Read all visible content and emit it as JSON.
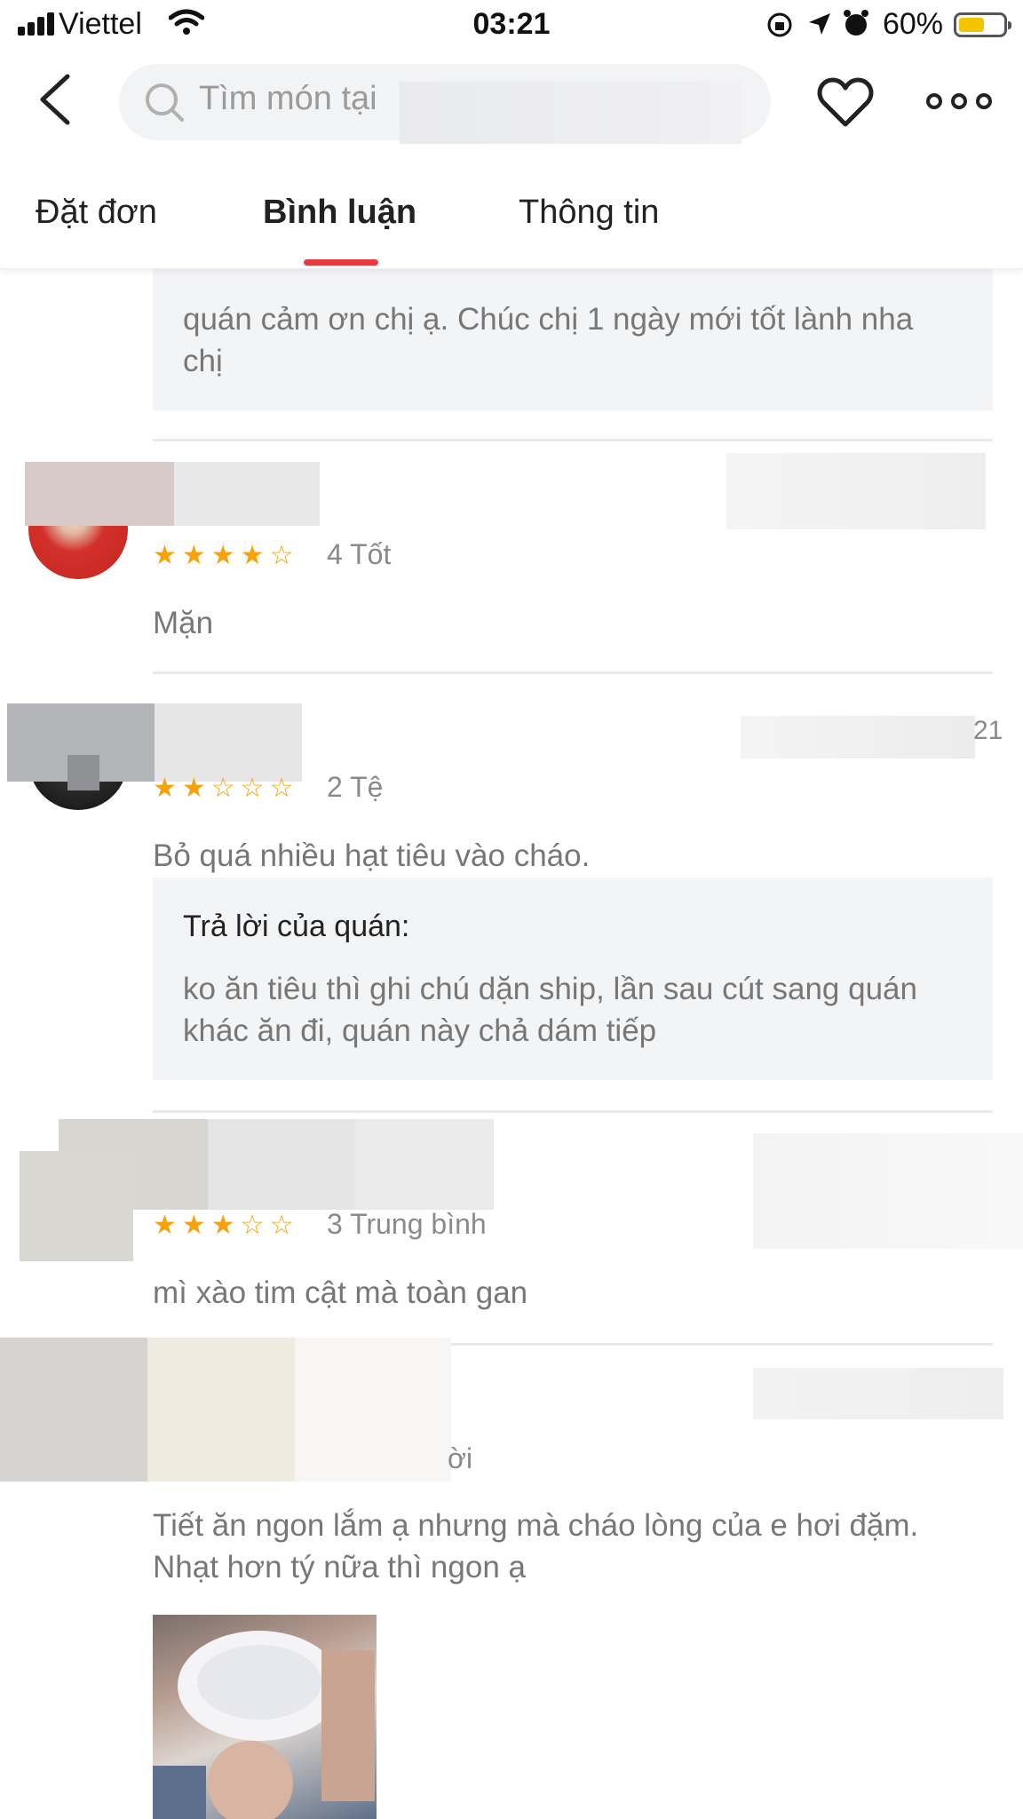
{
  "status": {
    "carrier": "Viettel",
    "time": "03:21",
    "battery": "60%",
    "battery_level": 0.6
  },
  "header": {
    "search_placeholder": "Tìm món tại"
  },
  "tabs": [
    {
      "label": "Đặt đơn"
    },
    {
      "label": "Bình luận",
      "active": true
    },
    {
      "label": "Thông tin"
    }
  ],
  "top_reply": {
    "text": "quán cảm ơn chị ạ. Chúc chị 1 ngày mới tốt lành nha chị"
  },
  "reviews": [
    {
      "stars_shown": "★★★★☆",
      "rating": 4,
      "rating_label": "4 Tốt",
      "comment": "Mặn"
    },
    {
      "stars_shown": "★★☆☆☆",
      "rating": 2,
      "rating_label": "2 Tệ",
      "comment": "Bỏ quá nhiều hạt tiêu vào cháo.",
      "reply_title": "Trả lời của quán:",
      "reply_text": "ko ăn tiêu thì ghi chú dặn ship, lần sau cút sang quán khác ăn đi, quán này chả dám tiếp",
      "date_fragment": "21"
    },
    {
      "stars_shown": "★★★☆☆",
      "rating": 3,
      "rating_label": "3 Trung bình",
      "comment": "mì xào tim cật mà toàn gan"
    },
    {
      "rating_label_fragment": "ời",
      "comment": "Tiết ăn ngon lắm ạ nhưng mà cháo lòng của e hơi đặm. Nhạt hơn tý nữa thì ngon ạ"
    }
  ],
  "colors": {
    "accent": "#e8393f",
    "star": "#f7a20b",
    "reply_bg": "#f3f4f6"
  }
}
